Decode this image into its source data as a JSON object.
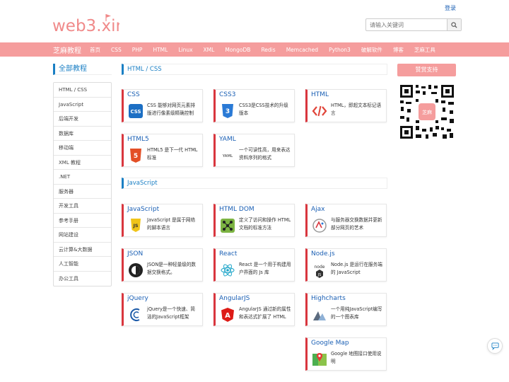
{
  "header": {
    "login_label": "登录",
    "search_placeholder": "请输入关键词"
  },
  "nav": {
    "brand": "芝麻教程",
    "items": [
      "首页",
      "CSS",
      "PHP",
      "HTML",
      "Linux",
      "XML",
      "MongoDB",
      "Redis",
      "Memcached",
      "Python3",
      "破解软件",
      "博客",
      "芝麻工具"
    ]
  },
  "sidebar": {
    "title": "全部教程",
    "items": [
      "HTML / CSS",
      "JavaScript",
      "后端开发",
      "数据库",
      "移动端",
      "XML 教程",
      ".NET",
      "服务器",
      "开发工具",
      "参考手册",
      "网站建设",
      "云计算&大数据",
      "人工智能",
      "办公工具"
    ]
  },
  "sections": [
    {
      "title": "HTML / CSS"
    },
    {
      "title": "JavaScript"
    }
  ],
  "cards": [
    {
      "title": "CSS",
      "desc": "CSS 能够对网页元素排版进行像素级精确控制",
      "icon": "css3-icon"
    },
    {
      "title": "CSS3",
      "desc": "CSS3是CSS技术的升级版本",
      "icon": "css3-shield-icon"
    },
    {
      "title": "HTML",
      "desc": "HTML，即超文本标记语言",
      "icon": "code-brackets-icon"
    },
    {
      "title": "HTML5",
      "desc": "HTML5 是下一代 HTML 标准",
      "icon": "html5-icon"
    },
    {
      "title": "YAML",
      "desc": "一个可读性高，用来表达资料序列的格式",
      "icon": "yaml-icon",
      "icon_text": "YAML"
    },
    {
      "title": "JavaScript",
      "desc": "JavaScript 是属于网络的脚本语言",
      "icon": "javascript-icon",
      "icon_text": "JS"
    },
    {
      "title": "HTML DOM",
      "desc": "定义了访问和操作 HTML 文档的标准方法",
      "icon": "dom-tree-icon"
    },
    {
      "title": "Ajax",
      "desc": "与服务器交换数据并更新部分网页的艺术",
      "icon": "ajax-icon"
    },
    {
      "title": "JSON",
      "desc": "JSON是一种轻量级的数据交换格式。",
      "icon": "json-icon"
    },
    {
      "title": "React",
      "desc": "React 是一个用于构建用户界面的 Js 库",
      "icon": "react-icon"
    },
    {
      "title": "Node.js",
      "desc": "Node.js 是运行在服务端的 JavaScript",
      "icon": "nodejs-icon",
      "icon_text": "node"
    },
    {
      "title": "jQuery",
      "desc": "jQuery是一个快速、简洁的JavaScript框架",
      "icon": "jquery-icon"
    },
    {
      "title": "AngularJS",
      "desc": "AngularJS 通过新的属性和表达式扩展了 HTML",
      "icon": "angular-icon",
      "icon_text": "A"
    },
    {
      "title": "Highcharts",
      "desc": "一个用纯JavaScript编写的一个图表库",
      "icon": "highcharts-icon"
    },
    {
      "title": "Google Map",
      "desc": "Google 地图接口使用说明",
      "icon": "google-map-icon"
    }
  ],
  "aside": {
    "donate_label": "赞赏支持",
    "qr_text": "芝麻"
  },
  "colors": {
    "nav_bg": "#f59d9d",
    "accent_blue": "#1a7fc4",
    "card_accent": "#d9363e"
  }
}
